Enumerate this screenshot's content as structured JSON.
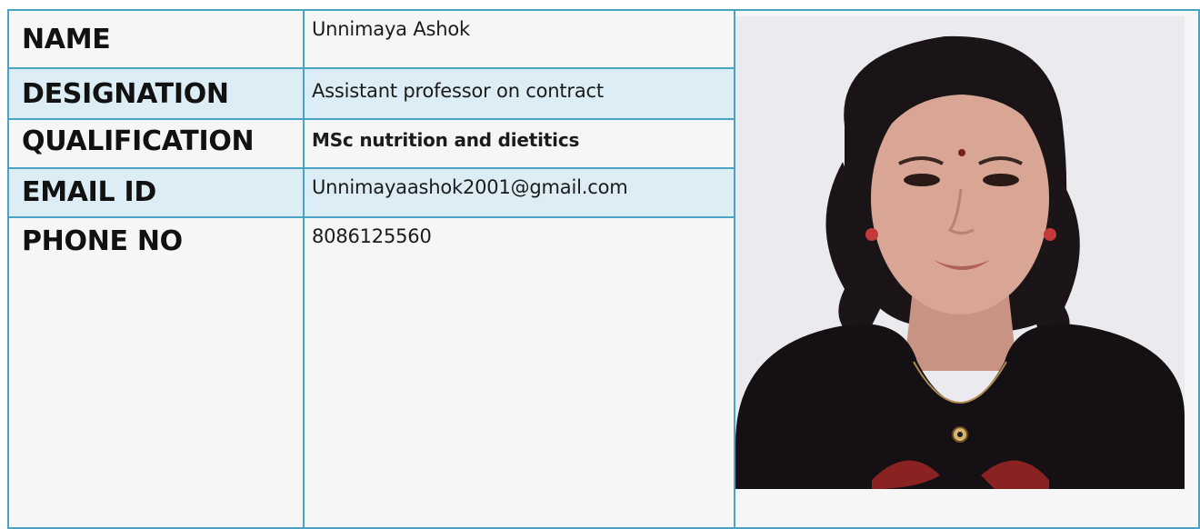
{
  "profile": {
    "name_label": "NAME",
    "name_value": "Unnimaya Ashok",
    "designation_label": "DESIGNATION",
    "designation_value": "Assistant professor on contract",
    "qualification_label": "QUALIFICATION",
    "qualification_value": "MSc nutrition  and dietitics",
    "email_label": "EMAIL ID",
    "email_value": "Unnimayaashok2001@gmail.com",
    "phone_label": "PHONE NO",
    "phone_value": "8086125560"
  },
  "colors": {
    "border": "#4aa3c4",
    "shaded_row": "#dcedf6",
    "plain_row": "#f6f6f6"
  }
}
